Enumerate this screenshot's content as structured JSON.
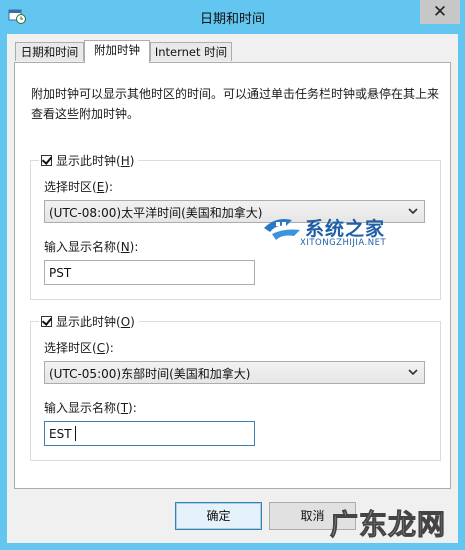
{
  "window": {
    "title": "日期和时间",
    "close_glyph": "✕"
  },
  "tabs": [
    {
      "label": "日期和时间",
      "active": false
    },
    {
      "label": "附加时钟",
      "active": true
    },
    {
      "label": "Internet 时间",
      "active": false
    }
  ],
  "description": "附加时钟可以显示其他时区的时间。可以通过单击任务栏时钟或悬停在其上来查看这些附加时钟。",
  "clock1": {
    "show_label": "显示此时钟(",
    "show_key": "H",
    "show_close": ")",
    "checked": true,
    "zone_label": "选择时区(",
    "zone_key": "E",
    "zone_close": "):",
    "zone_value": "(UTC-08:00)太平洋时间(美国和加拿大)",
    "name_label": "输入显示名称(",
    "name_key": "N",
    "name_close": "):",
    "name_value": "PST"
  },
  "clock2": {
    "show_label": "显示此时钟(",
    "show_key": "O",
    "show_close": ")",
    "checked": true,
    "zone_label": "选择时区(",
    "zone_key": "C",
    "zone_close": "):",
    "zone_value": "(UTC-05:00)东部时间(美国和加拿大)",
    "name_label": "输入显示名称(",
    "name_key": "T",
    "name_close": "):",
    "name_value": "EST"
  },
  "buttons": {
    "ok": "确定",
    "cancel": "取消"
  },
  "watermarks": {
    "site_name": "系统之家",
    "site_url": "XITONGZHIJIA.NET",
    "corner": "广东龙网"
  },
  "colors": {
    "accent": "#3c7fb1",
    "title_bg": "#63c6f0",
    "watermark_blue": "#1f5fa6"
  },
  "icons": [
    "clock-window-icon",
    "close-icon",
    "checkbox-checked-icon",
    "dropdown-arrow-icon",
    "watermark-logo-icon"
  ]
}
